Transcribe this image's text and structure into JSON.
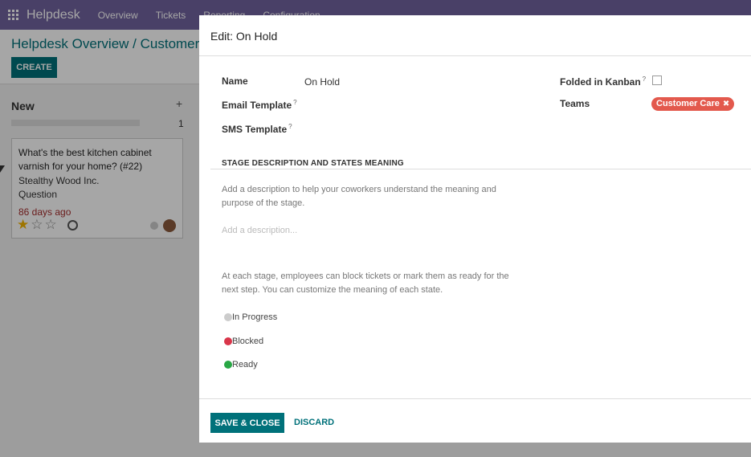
{
  "navbar": {
    "brand": "Helpdesk",
    "items": [
      "Overview",
      "Tickets",
      "Reporting",
      "Configuration"
    ]
  },
  "background": {
    "breadcrumb": "Helpdesk Overview / Customer C",
    "create_label": "CREATE",
    "column": {
      "title": "New",
      "add": "+",
      "count": "1"
    },
    "card": {
      "title": "What's the best kitchen cabinet varnish for your home? (#22)",
      "company": "Stealthy Wood Inc.",
      "type": "Question",
      "age": "86 days ago",
      "stars": "★☆☆",
      "priority_filled": 1
    }
  },
  "modal": {
    "title": "Edit: On Hold",
    "fields": {
      "name_label": "Name",
      "name_value": "On Hold",
      "email_template_label": "Email Template",
      "sms_template_label": "SMS Template",
      "help_marker": "?",
      "folded_label": "Folded in Kanban",
      "folded_checked": false,
      "teams_label": "Teams",
      "team_tag": "Customer Care",
      "tag_remove": "✖"
    },
    "section_title": "STAGE DESCRIPTION AND STATES MEANING",
    "description_help": "Add a description to help your coworkers understand the meaning and purpose of the stage.",
    "description_placeholder": "Add a description...",
    "states_help": "At each stage, employees can block tickets or mark them as ready for the next step. You can customize the meaning of each state.",
    "states": [
      {
        "label": "In Progress",
        "color": "#cccccc"
      },
      {
        "label": "Blocked",
        "color": "#d9364a"
      },
      {
        "label": "Ready",
        "color": "#28a745"
      }
    ],
    "save_label": "SAVE & CLOSE",
    "discard_label": "DISCARD"
  },
  "colors": {
    "primary": "#00717a",
    "navbar": "#71639e",
    "tag": "#e3594d"
  }
}
